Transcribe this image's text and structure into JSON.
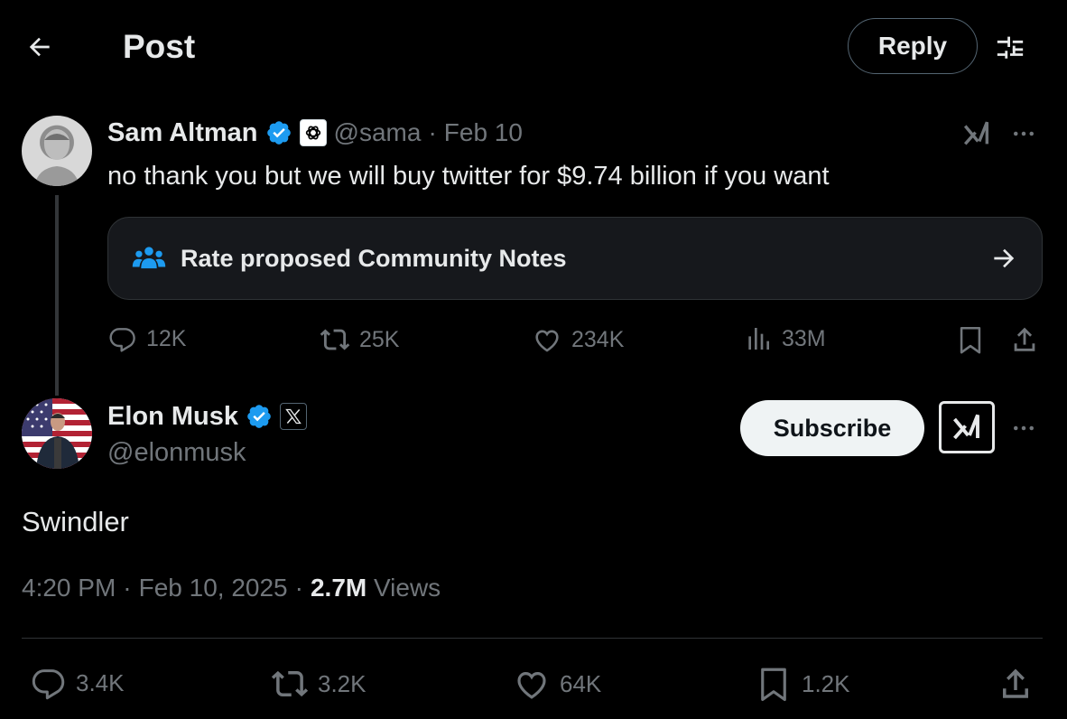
{
  "header": {
    "title": "Post",
    "reply_label": "Reply"
  },
  "parent_post": {
    "author_name": "Sam Altman",
    "handle": "@sama",
    "separator": "·",
    "date": "Feb 10",
    "text": "no thank you but we will buy twitter for $9.74 billion if you want",
    "community_notes_label": "Rate proposed Community Notes",
    "stats": {
      "replies": "12K",
      "reposts": "25K",
      "likes": "234K",
      "views": "33M"
    }
  },
  "main_post": {
    "author_name": "Elon Musk",
    "handle": "@elonmusk",
    "subscribe_label": "Subscribe",
    "text": "Swindler",
    "time": "4:20 PM",
    "sep1": "·",
    "date": "Feb 10, 2025",
    "sep2": "·",
    "views_count": "2.7M",
    "views_label": "Views",
    "stats": {
      "replies": "3.4K",
      "reposts": "3.2K",
      "likes": "64K",
      "bookmarks": "1.2K"
    }
  },
  "colors": {
    "background": "#000000",
    "text": "#e7e9ea",
    "muted": "#71767b",
    "verified": "#1d9bf0",
    "community_notes": "#1d9bf0"
  }
}
